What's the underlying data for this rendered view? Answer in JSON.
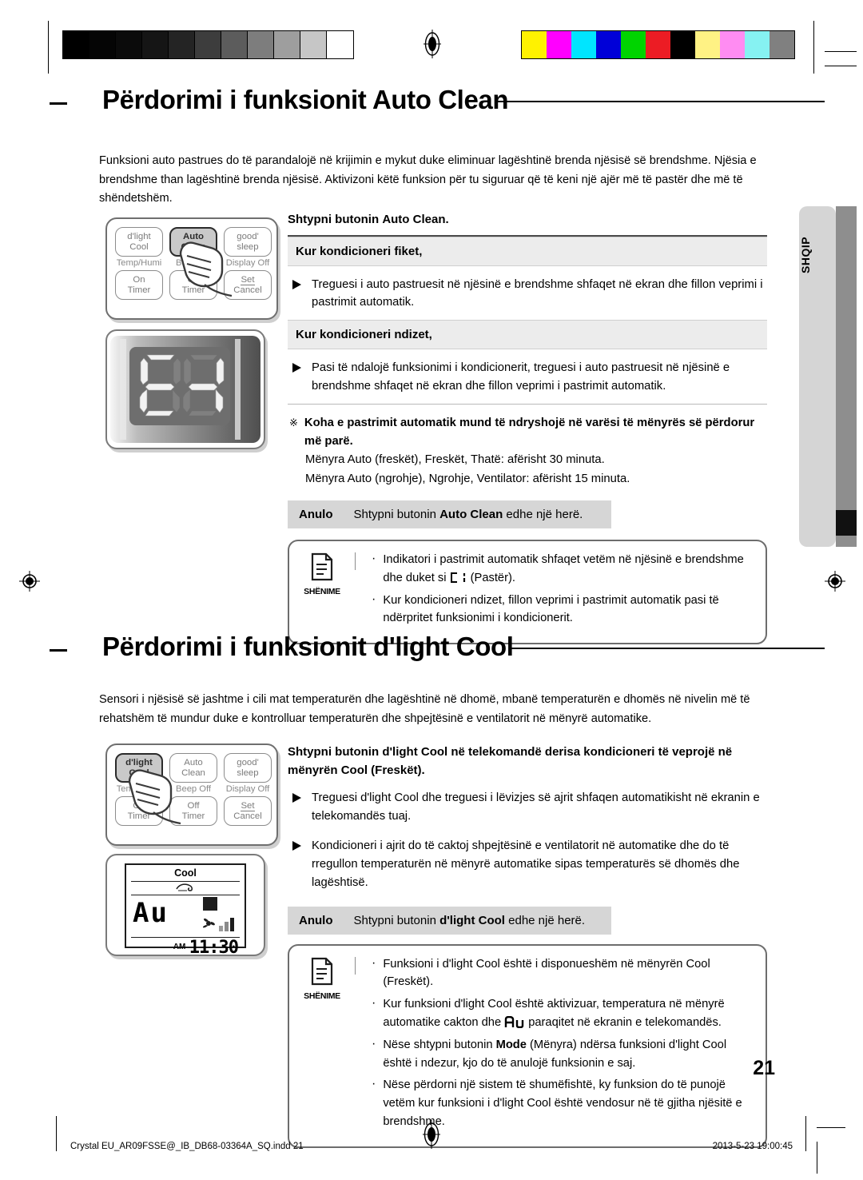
{
  "calibration": {
    "grayscale": [
      "#000000",
      "#050505",
      "#0b0b0b",
      "#151515",
      "#242424",
      "#3d3d3d",
      "#5c5c5c",
      "#7d7d7d",
      "#9e9e9e",
      "#c6c6c6",
      "#ffffff"
    ],
    "colors": [
      "#fff200",
      "#ff00ff",
      "#00e5ff",
      "#0000d8",
      "#00d400",
      "#ec1c24",
      "#000000",
      "#fff284",
      "#ff8cf2",
      "#86f2f2",
      "#808080"
    ]
  },
  "section1": {
    "heading": "Përdorimi i funksionit Auto Clean",
    "intro": "Funksioni auto pastrues do të parandalojë në krijimin e mykut duke eliminuar lagështinë brenda njësisë së brendshme. Njësia e brendshme than lagështinë brenda njësisë. Aktivizoni këtë funksion për tu siguruar që të keni një ajër më të pastër dhe më të shëndetshëm.",
    "lead": "Shtypni butonin Auto Clean.",
    "lead_plain": "Shtypni butonin ",
    "lead_bold": "Auto Clean.",
    "band1": "Kur kondicioneri fiket,",
    "bullet1": "Treguesi i auto pastruesit në njësinë e brendshme shfaqet në ekran dhe fillon veprimi i pastrimit automatik.",
    "band2": "Kur kondicioneri ndizet,",
    "bullet2": "Pasi të ndalojë funksionimi i kondicionerit, treguesi i auto pastruesit në njësinë e brendshme shfaqet në ekran dhe fillon veprimi i pastrimit automatik.",
    "star_symbol": "※",
    "star_bold": "Koha e pastrimit automatik mund të ndryshojë në varësi të mënyrës së përdorur më parë.",
    "star_line1": "Mënyra Auto (freskët), Freskët, Thatë: afërisht 30 minuta.",
    "star_line2": "Mënyra Auto (ngrohje), Ngrohje, Ventilator: afërisht 15 minuta.",
    "anulo_label": "Anulo",
    "anulo_pre": "Shtypni butonin ",
    "anulo_bold": "Auto Clean",
    "anulo_post": " edhe një herë.",
    "note_caption": "SHËNIME",
    "note1_pre": "Indikatori i pastrimit automatik shfaqet vetëm në njësinë e brendshme dhe duket si ",
    "note1_post": "(Pastër).",
    "note2": "Kur kondicioneri ndizet, fillon veprimi i pastrimit automatik pasi të ndërpritet funksionimi i kondicionerit."
  },
  "section2": {
    "heading": "Përdorimi i funksionit d'light Cool",
    "intro": "Sensori i njësisë së jashtme i cili mat temperaturën dhe lagështinë në dhomë, mbanë temperaturën e dhomës në nivelin më të rehatshëm të mundur duke e kontrolluar temperaturën dhe shpejtësinë e ventilatorit në mënyrë automatike.",
    "lead_pre": "Shtypni butonin ",
    "lead_bold": "d'light Cool",
    "lead_post": " në telekomandë derisa kondicioneri të veprojë në mënyrën Cool (Freskët).",
    "bullet1": "Treguesi d'light Cool dhe treguesi i lëvizjes së ajrit shfaqen automatikisht në ekranin e telekomandës tuaj.",
    "bullet2": "Kondicioneri i ajrit do të caktoj shpejtësinë e ventilatorit në automatike dhe do të rregullon temperaturën në mënyrë automatike sipas temperaturës së dhomës dhe lagështisë.",
    "anulo_label": "Anulo",
    "anulo_pre": "Shtypni butonin ",
    "anulo_bold": "d'light Cool",
    "anulo_post": " edhe një herë.",
    "note_caption": "SHËNIME",
    "note1": "Funksioni i d'light Cool është i disponueshëm në mënyrën Cool (Freskët).",
    "note2_pre": "Kur funksioni d'light Cool është aktivizuar, temperatura në mënyrë automatike cakton dhe ",
    "note2_post": "paraqitet në ekranin e telekomandës.",
    "note3_pre": "Nëse shtypni butonin ",
    "note3_bold": "Mode",
    "note3_post": " (Mënyra) ndërsa funksioni d'light Cool është i ndezur, kjo do të anulojë funksionin e saj.",
    "note4": "Nëse përdorni një sistem të shumëfishtë, ky funksion do të punojë vetëm kur funksioni i d'light Cool është vendosur në të gjitha njësitë e brendshme."
  },
  "remote1": {
    "buttons": [
      {
        "line1": "d'light",
        "line2": "Cool",
        "highlighted": false
      },
      {
        "line1": "Auto",
        "line2": "Clean",
        "highlighted": true
      },
      {
        "line1": "good'",
        "line2": "sleep",
        "highlighted": false
      }
    ],
    "sublabels": [
      "Temp/Humi",
      "Beep Off",
      "Display Off"
    ],
    "buttons2": [
      {
        "line1": "On",
        "line2": "Timer"
      },
      {
        "line1": "Off",
        "line2": "Timer"
      },
      {
        "line1": "Set",
        "line2": "Cancel"
      }
    ]
  },
  "remote2": {
    "buttons": [
      {
        "line1": "d'light",
        "line2": "Cool",
        "highlighted": true
      },
      {
        "line1": "Auto",
        "line2": "Clean",
        "highlighted": false
      },
      {
        "line1": "good'",
        "line2": "sleep",
        "highlighted": false
      }
    ],
    "sublabels": [
      "Temp/Humi",
      "Beep Off",
      "Display Off"
    ],
    "buttons2": [
      {
        "line1": "On",
        "line2": "Timer"
      },
      {
        "line1": "Off",
        "line2": "Timer"
      },
      {
        "line1": "Set",
        "line2": "Cancel"
      }
    ]
  },
  "lcd": {
    "mode_label": "Cool",
    "segment_text": "Au",
    "ampm": "AM",
    "time": "11:30"
  },
  "sidetab": {
    "label": "SHQIP"
  },
  "page_number": "21",
  "footer": {
    "left": "Crystal EU_AR09FSSE@_IB_DB68-03364A_SQ.indd   21",
    "right": "2013-5-23   19:00:45"
  }
}
